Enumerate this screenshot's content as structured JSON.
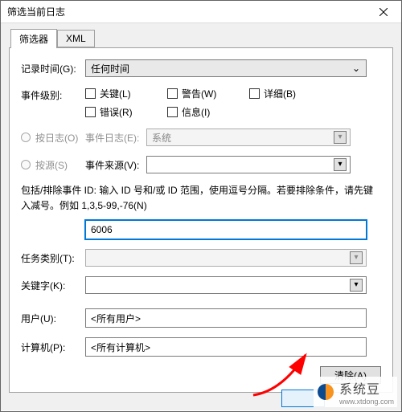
{
  "window": {
    "title": "筛选当前日志"
  },
  "tabs": {
    "filter": "筛选器",
    "xml": "XML"
  },
  "labels": {
    "logged": "记录时间(G):",
    "level": "事件级别:",
    "bylog": "按日志(O)",
    "bysource": "按源(S)",
    "eventlogs": "事件日志(E):",
    "eventsources": "事件来源(V):",
    "task": "任务类别(T):",
    "keywords": "关键字(K):",
    "user": "用户(U):",
    "computer": "计算机(P):"
  },
  "combos": {
    "logged": "任何时间",
    "eventlogs": "系统",
    "eventsources": "",
    "task": "",
    "keywords": ""
  },
  "checks": {
    "critical": "关键(L)",
    "warning": "警告(W)",
    "verbose": "详细(B)",
    "error": "错误(R)",
    "info": "信息(I)"
  },
  "desc": "包括/排除事件 ID: 输入 ID 号和/或 ID 范围，使用逗号分隔。若要排除条件，请先键入减号。例如 1,3,5-99,-76(N)",
  "eventid": "6006",
  "user": "<所有用户>",
  "computer": "<所有计算机>",
  "buttons": {
    "clear": "清除(A)"
  },
  "watermark": "系统豆",
  "watermark_url": "www.xtdong.com"
}
